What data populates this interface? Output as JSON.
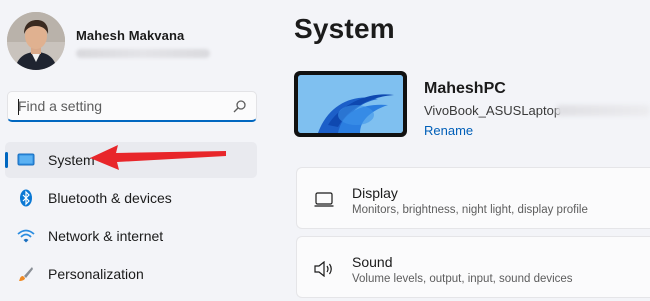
{
  "profile": {
    "name": "Mahesh Makvana"
  },
  "search": {
    "placeholder": "Find a setting"
  },
  "nav": {
    "items": [
      {
        "label": "System",
        "icon": "monitor-icon",
        "active": true
      },
      {
        "label": "Bluetooth & devices",
        "icon": "bluetooth-icon"
      },
      {
        "label": "Network & internet",
        "icon": "wifi-icon"
      },
      {
        "label": "Personalization",
        "icon": "brush-icon"
      }
    ]
  },
  "main": {
    "title": "System",
    "device": {
      "name": "MaheshPC",
      "model": "VivoBook_ASUSLaptop",
      "rename_label": "Rename"
    },
    "cards": [
      {
        "title": "Display",
        "description": "Monitors, brightness, night light, display profile",
        "icon": "display-icon"
      },
      {
        "title": "Sound",
        "description": "Volume levels, output, input, sound devices",
        "icon": "speaker-icon"
      }
    ]
  },
  "colors": {
    "accent": "#0067c0",
    "annotation_arrow": "#e8262a",
    "background": "#f3f4f8"
  }
}
